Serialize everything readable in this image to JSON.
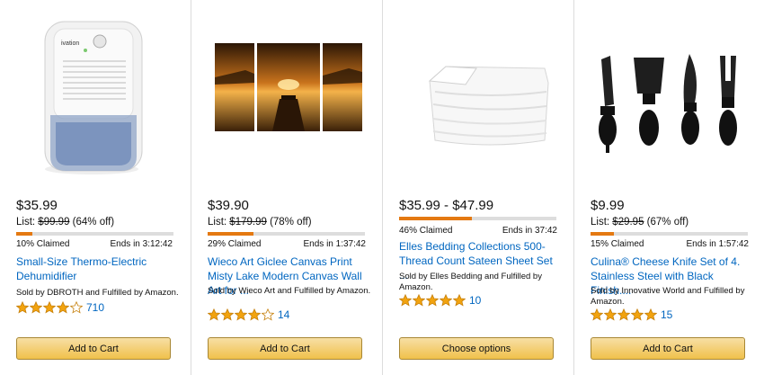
{
  "deals": [
    {
      "image": "dehumidifier-image",
      "brand_label": "ivation",
      "price": "$35.99",
      "list_prefix": "List: ",
      "list_price": "$99.99",
      "discount": " (64% off)",
      "claimed_fraction": 0.1,
      "claimed_text": "10% Claimed",
      "ends_text": "Ends in 3:12:42",
      "title": "Small-Size Thermo-Electric Dehumidifier",
      "seller": "Sold by DBROTH and Fulfilled by Amazon.",
      "stars": 4.0,
      "review_count": "710",
      "button_label": "Add to Cart"
    },
    {
      "image": "canvas-print-image",
      "price": "$39.90",
      "list_prefix": "List: ",
      "list_price": "$179.99",
      "discount": " (78% off)",
      "claimed_fraction": 0.29,
      "claimed_text": "29% Claimed",
      "ends_text": "Ends in 1:37:42",
      "title": "Wieco Art Giclee Canvas Print Misty Lake Modern Canvas Wall Art for ...",
      "seller": "Sold by Wieco Art and Fulfilled by Amazon.",
      "stars": 4.0,
      "review_count": "14",
      "button_label": "Add to Cart"
    },
    {
      "image": "bed-sheets-image",
      "price": "$35.99 - $47.99",
      "list_prefix": "",
      "list_price": "",
      "discount": "",
      "claimed_fraction": 0.46,
      "claimed_text": "46% Claimed",
      "ends_text": "Ends in 37:42",
      "title": "Elles Bedding Collections 500-Thread Count Sateen Sheet Set ...",
      "seller": "Sold by Elles Bedding and Fulfilled by Amazon.",
      "stars": 5.0,
      "review_count": "10",
      "button_label": "Choose options"
    },
    {
      "image": "cheese-knife-set-image",
      "price": "$9.99",
      "list_prefix": "List: ",
      "list_price": "$29.95",
      "discount": " (67% off)",
      "claimed_fraction": 0.15,
      "claimed_text": "15% Claimed",
      "ends_text": "Ends in 1:57:42",
      "title": "Culina® Cheese Knife Set of 4. Stainless Steel with Black Finish....",
      "seller": "Sold by Innovative World and Fulfilled by Amazon.",
      "stars": 5.0,
      "review_count": "15",
      "button_label": "Add to Cart"
    }
  ],
  "colors": {
    "link": "#0066c0",
    "progress": "#e47911",
    "star": "#f2a30f",
    "button_top": "#f7dfa5",
    "button_bottom": "#f0c14b"
  }
}
